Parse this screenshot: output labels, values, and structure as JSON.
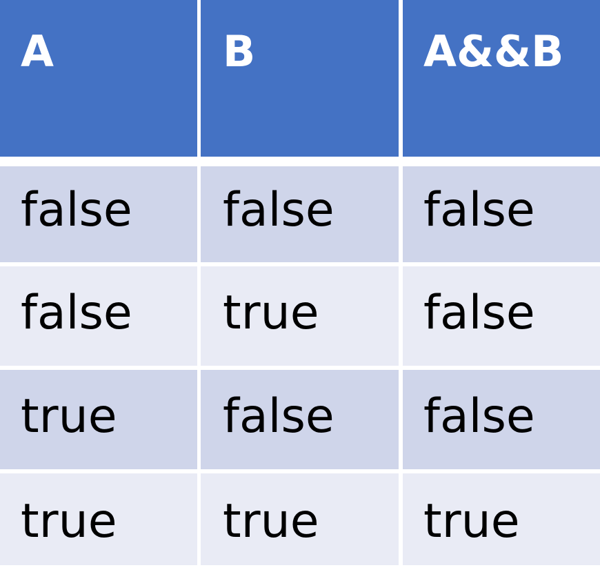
{
  "table": {
    "headers": [
      "A",
      "B",
      "A&&B"
    ],
    "rows": [
      [
        "false",
        "false",
        "false"
      ],
      [
        "false",
        "true",
        "false"
      ],
      [
        "true",
        "false",
        "false"
      ],
      [
        "true",
        "true",
        "true"
      ]
    ]
  },
  "colors": {
    "header_bg": "#4472c4",
    "header_text": "#ffffff",
    "row_dark": "#cfd5ea",
    "row_light": "#e9ebf5",
    "body_text": "#000000"
  }
}
